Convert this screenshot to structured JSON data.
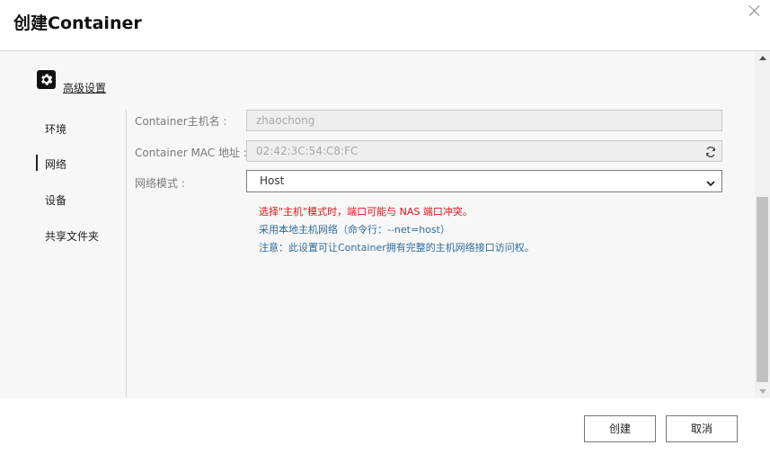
{
  "dialog": {
    "title": "创建Container"
  },
  "section": {
    "title": "高级设置",
    "icon": "gear-icon"
  },
  "nav": {
    "items": [
      {
        "label": "环境"
      },
      {
        "label": "网络"
      },
      {
        "label": "设备"
      },
      {
        "label": "共享文件夹"
      }
    ],
    "active": "网络"
  },
  "form": {
    "hostname": {
      "label": "Container主机名 :",
      "value": "zhaochong"
    },
    "mac": {
      "label": "Container MAC 地址 :",
      "value": "02:42:3C:54:C8:FC"
    },
    "network_mode": {
      "label": "网络模式 :",
      "value": "Host"
    }
  },
  "notes": {
    "warning": "选择\"主机\"模式时，端口可能与 NAS 端口冲突。",
    "info1": "采用本地主机网络（命令行：--net=host）",
    "info2": "注意：此设置可让Container拥有完整的主机网络接口访问权。"
  },
  "buttons": {
    "create": "创建",
    "cancel": "取消"
  },
  "colors": {
    "warning": "#e0151b",
    "info": "#2d6c9b",
    "panel_bg": "#f7f7f7"
  }
}
